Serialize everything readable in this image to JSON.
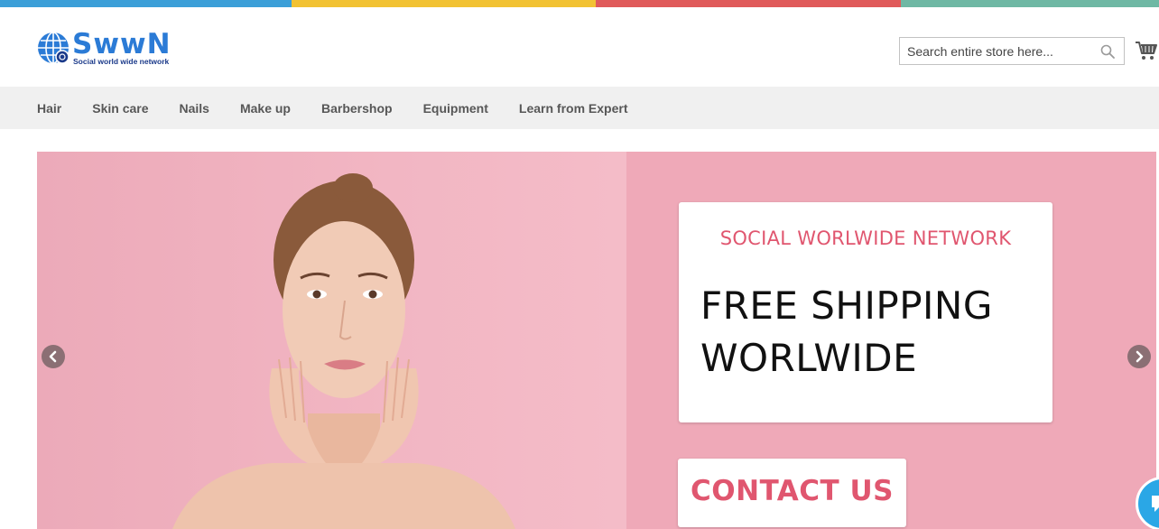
{
  "brand": {
    "name": "SwwN",
    "tagline": "Social world wide network",
    "colors": {
      "primary": "#2b7bd6",
      "accent": "#e0566f"
    }
  },
  "topbar_colors": [
    "#3b9fd8",
    "#f2c233",
    "#e05a5a",
    "#6fb8a4"
  ],
  "search": {
    "placeholder": "Search entire store here...",
    "value": ""
  },
  "cart": {
    "icon": "cart-icon"
  },
  "nav": {
    "items": [
      "Hair",
      "Skin care",
      "Nails",
      "Make up",
      "Barbershop",
      "Equipment",
      "Learn from Expert"
    ]
  },
  "hero": {
    "eyebrow": "SOCIAL WORLWIDE NETWORK",
    "headline_line1": "FREE SHIPPING",
    "headline_line2": "WORLWIDE",
    "cta_label": "CONTACT US",
    "background_color": "#efa9b8"
  }
}
